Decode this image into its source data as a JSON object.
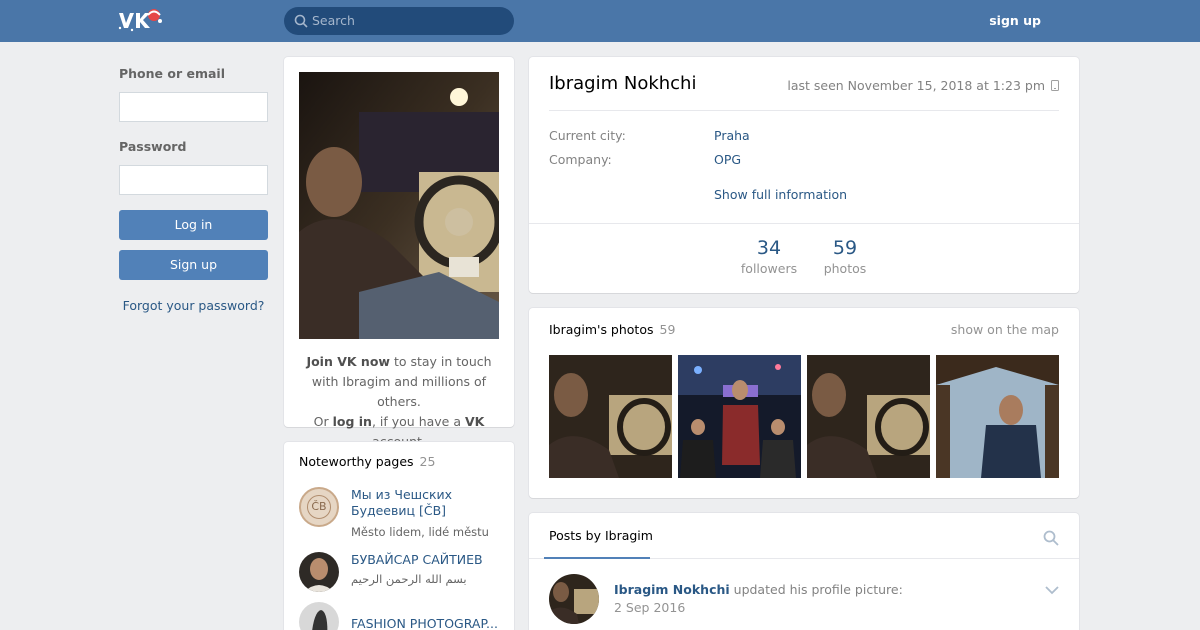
{
  "header": {
    "search_placeholder": "Search",
    "signup_label": "sign up",
    "colors": {
      "bar": "#4a76a8",
      "search_bg": "#224b7a"
    }
  },
  "login": {
    "phone_label": "Phone or email",
    "password_label": "Password",
    "login_button": "Log in",
    "signup_button": "Sign up",
    "forgot_link": "Forgot your password?"
  },
  "join": {
    "part1": "Join VK now",
    "part2": " to stay in touch with Ibragim and millions of others.",
    "part3": "Or ",
    "part4": "log in",
    "part5": ", if you have a ",
    "part6": "VK",
    "part7": " account."
  },
  "noteworthy": {
    "title": "Noteworthy pages",
    "count": "25",
    "pages": [
      {
        "name": "Мы из Чешских Будеевиц [ČB]",
        "subtitle": "Město lidem, lidé městu",
        "avatar_text": "ČB"
      },
      {
        "name": "БУВАЙСАР САЙТИЕВ",
        "subtitle": "بسم الله الرحمن الرحيم"
      },
      {
        "name": "FASHION PHOTOGRAP..."
      }
    ]
  },
  "profile": {
    "name": "Ibragim Nokhchi",
    "last_seen": "last seen November 15, 2018 at 1:23 pm",
    "current_city_label": "Current city:",
    "current_city": "Praha",
    "company_label": "Company:",
    "company": "OPG",
    "show_full": "Show full information",
    "followers_count": "34",
    "followers_label": "followers",
    "photos_count": "59",
    "photos_label": "photos"
  },
  "photos": {
    "title": "Ibragim's photos",
    "count": "59",
    "map_link": "show on the map"
  },
  "posts": {
    "tab_label": "Posts by Ibragim",
    "author": "Ibragim Nokhchi",
    "action": " updated his profile picture:",
    "date": "2 Sep 2016"
  }
}
